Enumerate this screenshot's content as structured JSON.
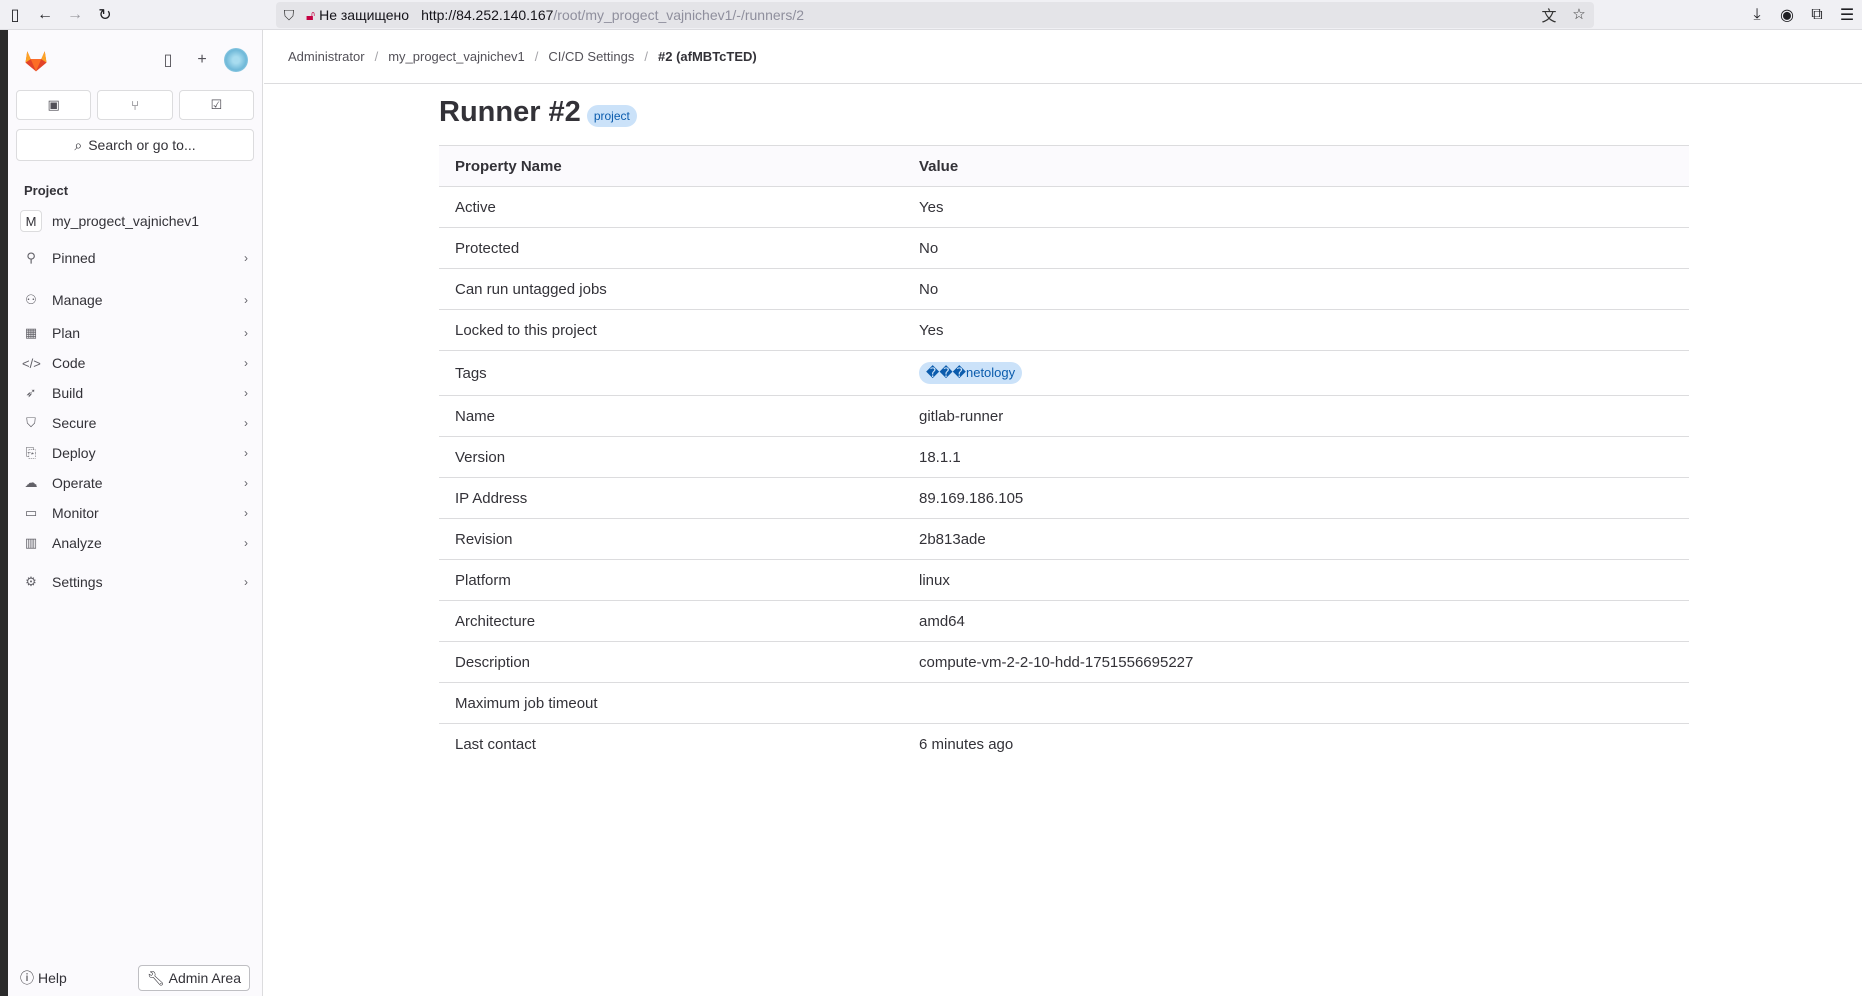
{
  "browser": {
    "security_label": "Не защищено",
    "url_host": "http://84.252.140.167",
    "url_path": "/root/my_progect_vajnichev1/-/runners/2"
  },
  "sidebar": {
    "search_label": "Search or go to...",
    "section_label": "Project",
    "project": {
      "initial": "M",
      "name": "my_progect_vajnichev1"
    },
    "nav_items": [
      {
        "label": "Pinned",
        "icon": "pin-icon"
      },
      {
        "label": "Manage",
        "icon": "users-icon"
      },
      {
        "label": "Plan",
        "icon": "calendar-icon"
      },
      {
        "label": "Code",
        "icon": "code-icon"
      },
      {
        "label": "Build",
        "icon": "rocket-icon"
      },
      {
        "label": "Secure",
        "icon": "shield-icon"
      },
      {
        "label": "Deploy",
        "icon": "deploy-icon"
      },
      {
        "label": "Operate",
        "icon": "cloud-gear-icon"
      },
      {
        "label": "Monitor",
        "icon": "monitor-icon"
      },
      {
        "label": "Analyze",
        "icon": "chart-icon"
      },
      {
        "label": "Settings",
        "icon": "gear-icon"
      }
    ],
    "help_label": "Help",
    "admin_label": "Admin Area"
  },
  "breadcrumbs": [
    "Administrator",
    "my_progect_vajnichev1",
    "CI/CD Settings",
    "#2 (afMBTcTED)"
  ],
  "page": {
    "title": "Runner #2",
    "badge": "project"
  },
  "table": {
    "headers": [
      "Property Name",
      "Value"
    ],
    "rows": [
      {
        "name": "Active",
        "value": "Yes"
      },
      {
        "name": "Protected",
        "value": "No"
      },
      {
        "name": "Can run untagged jobs",
        "value": "No"
      },
      {
        "name": "Locked to this project",
        "value": "Yes"
      },
      {
        "name": "Tags",
        "tag": "���netology"
      },
      {
        "name": "Name",
        "value": "gitlab-runner"
      },
      {
        "name": "Version",
        "value": "18.1.1"
      },
      {
        "name": "IP Address",
        "value": "89.169.186.105"
      },
      {
        "name": "Revision",
        "value": "2b813ade"
      },
      {
        "name": "Platform",
        "value": "linux"
      },
      {
        "name": "Architecture",
        "value": "amd64"
      },
      {
        "name": "Description",
        "value": "compute-vm-2-2-10-hdd-1751556695227"
      },
      {
        "name": "Maximum job timeout",
        "value": ""
      },
      {
        "name": "Last contact",
        "value": "6 minutes ago"
      }
    ]
  }
}
